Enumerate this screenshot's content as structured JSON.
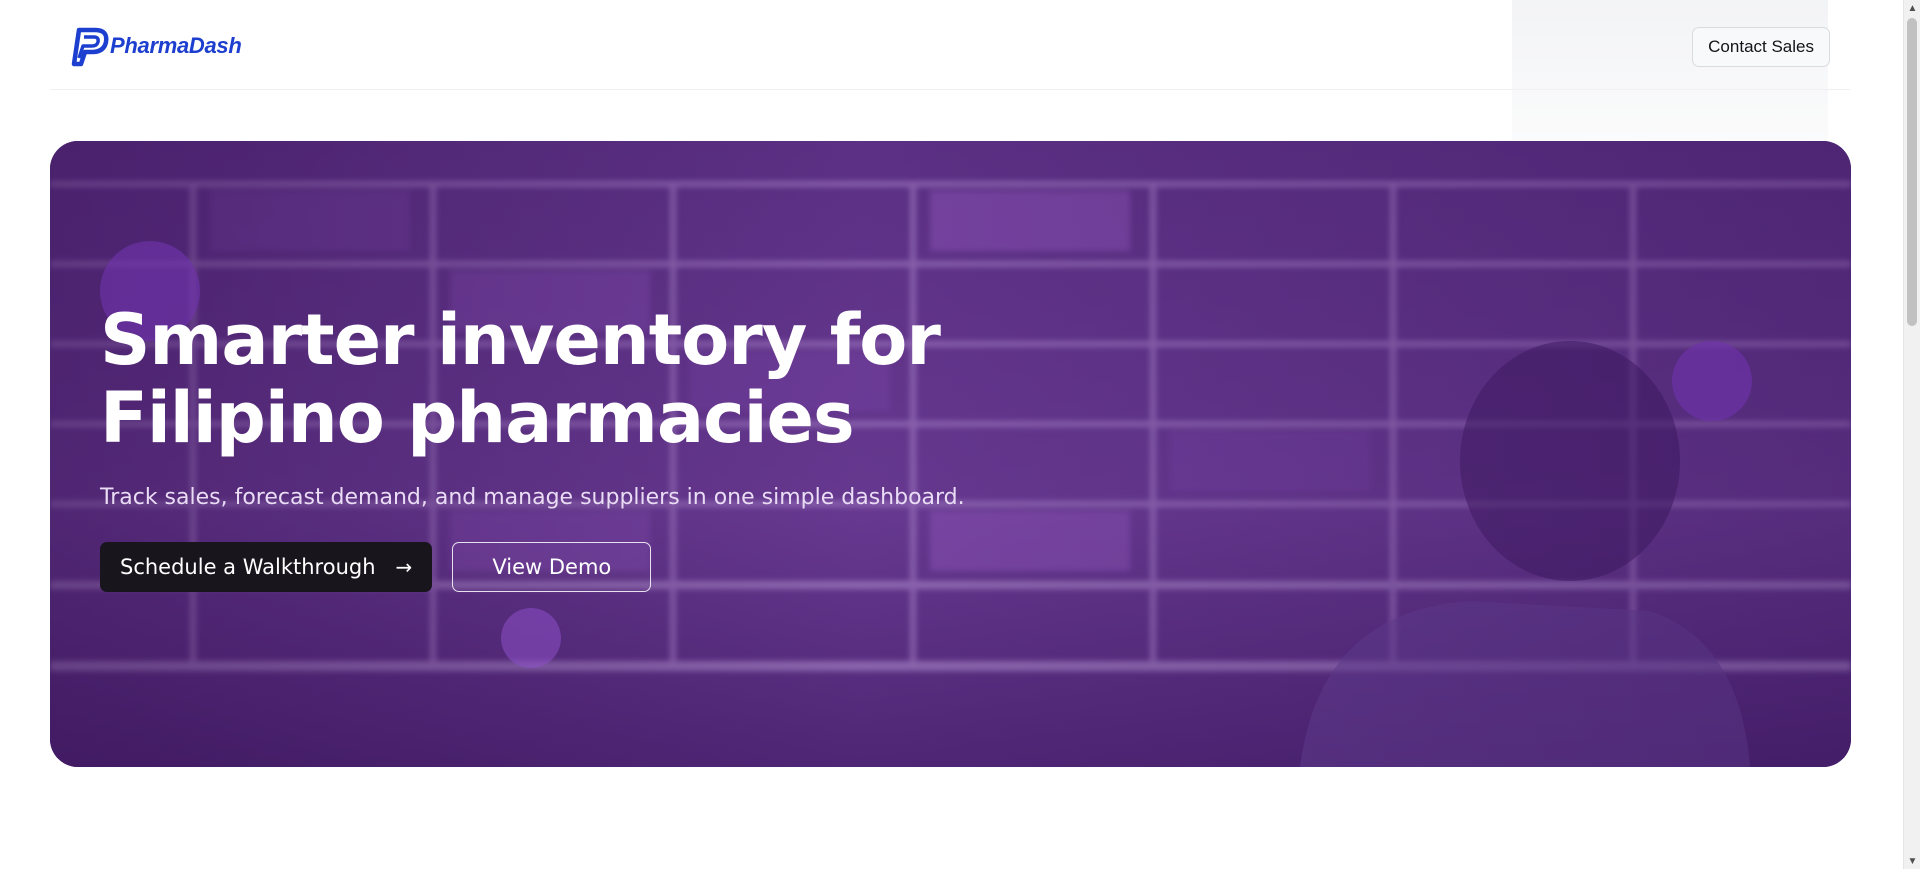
{
  "brand": {
    "name": "PharmaDash",
    "logo_icon": "pharmadash-logo-icon",
    "color": "#1d3fcf"
  },
  "header": {
    "contact_label": "Contact Sales"
  },
  "hero": {
    "title_line1": "Smarter inventory for",
    "title_line2": "Filipino pharmacies",
    "subtitle": "Track sales, forecast demand, and manage suppliers in one simple dashboard.",
    "primary_cta": "Schedule a Walkthrough",
    "primary_cta_icon": "arrow-right-icon",
    "secondary_cta": "View Demo",
    "overlay_color": "#5a2a85"
  },
  "colors": {
    "accent": "#1d3fcf",
    "hero_purple": "#4c2a72",
    "button_dark": "#18161c"
  }
}
